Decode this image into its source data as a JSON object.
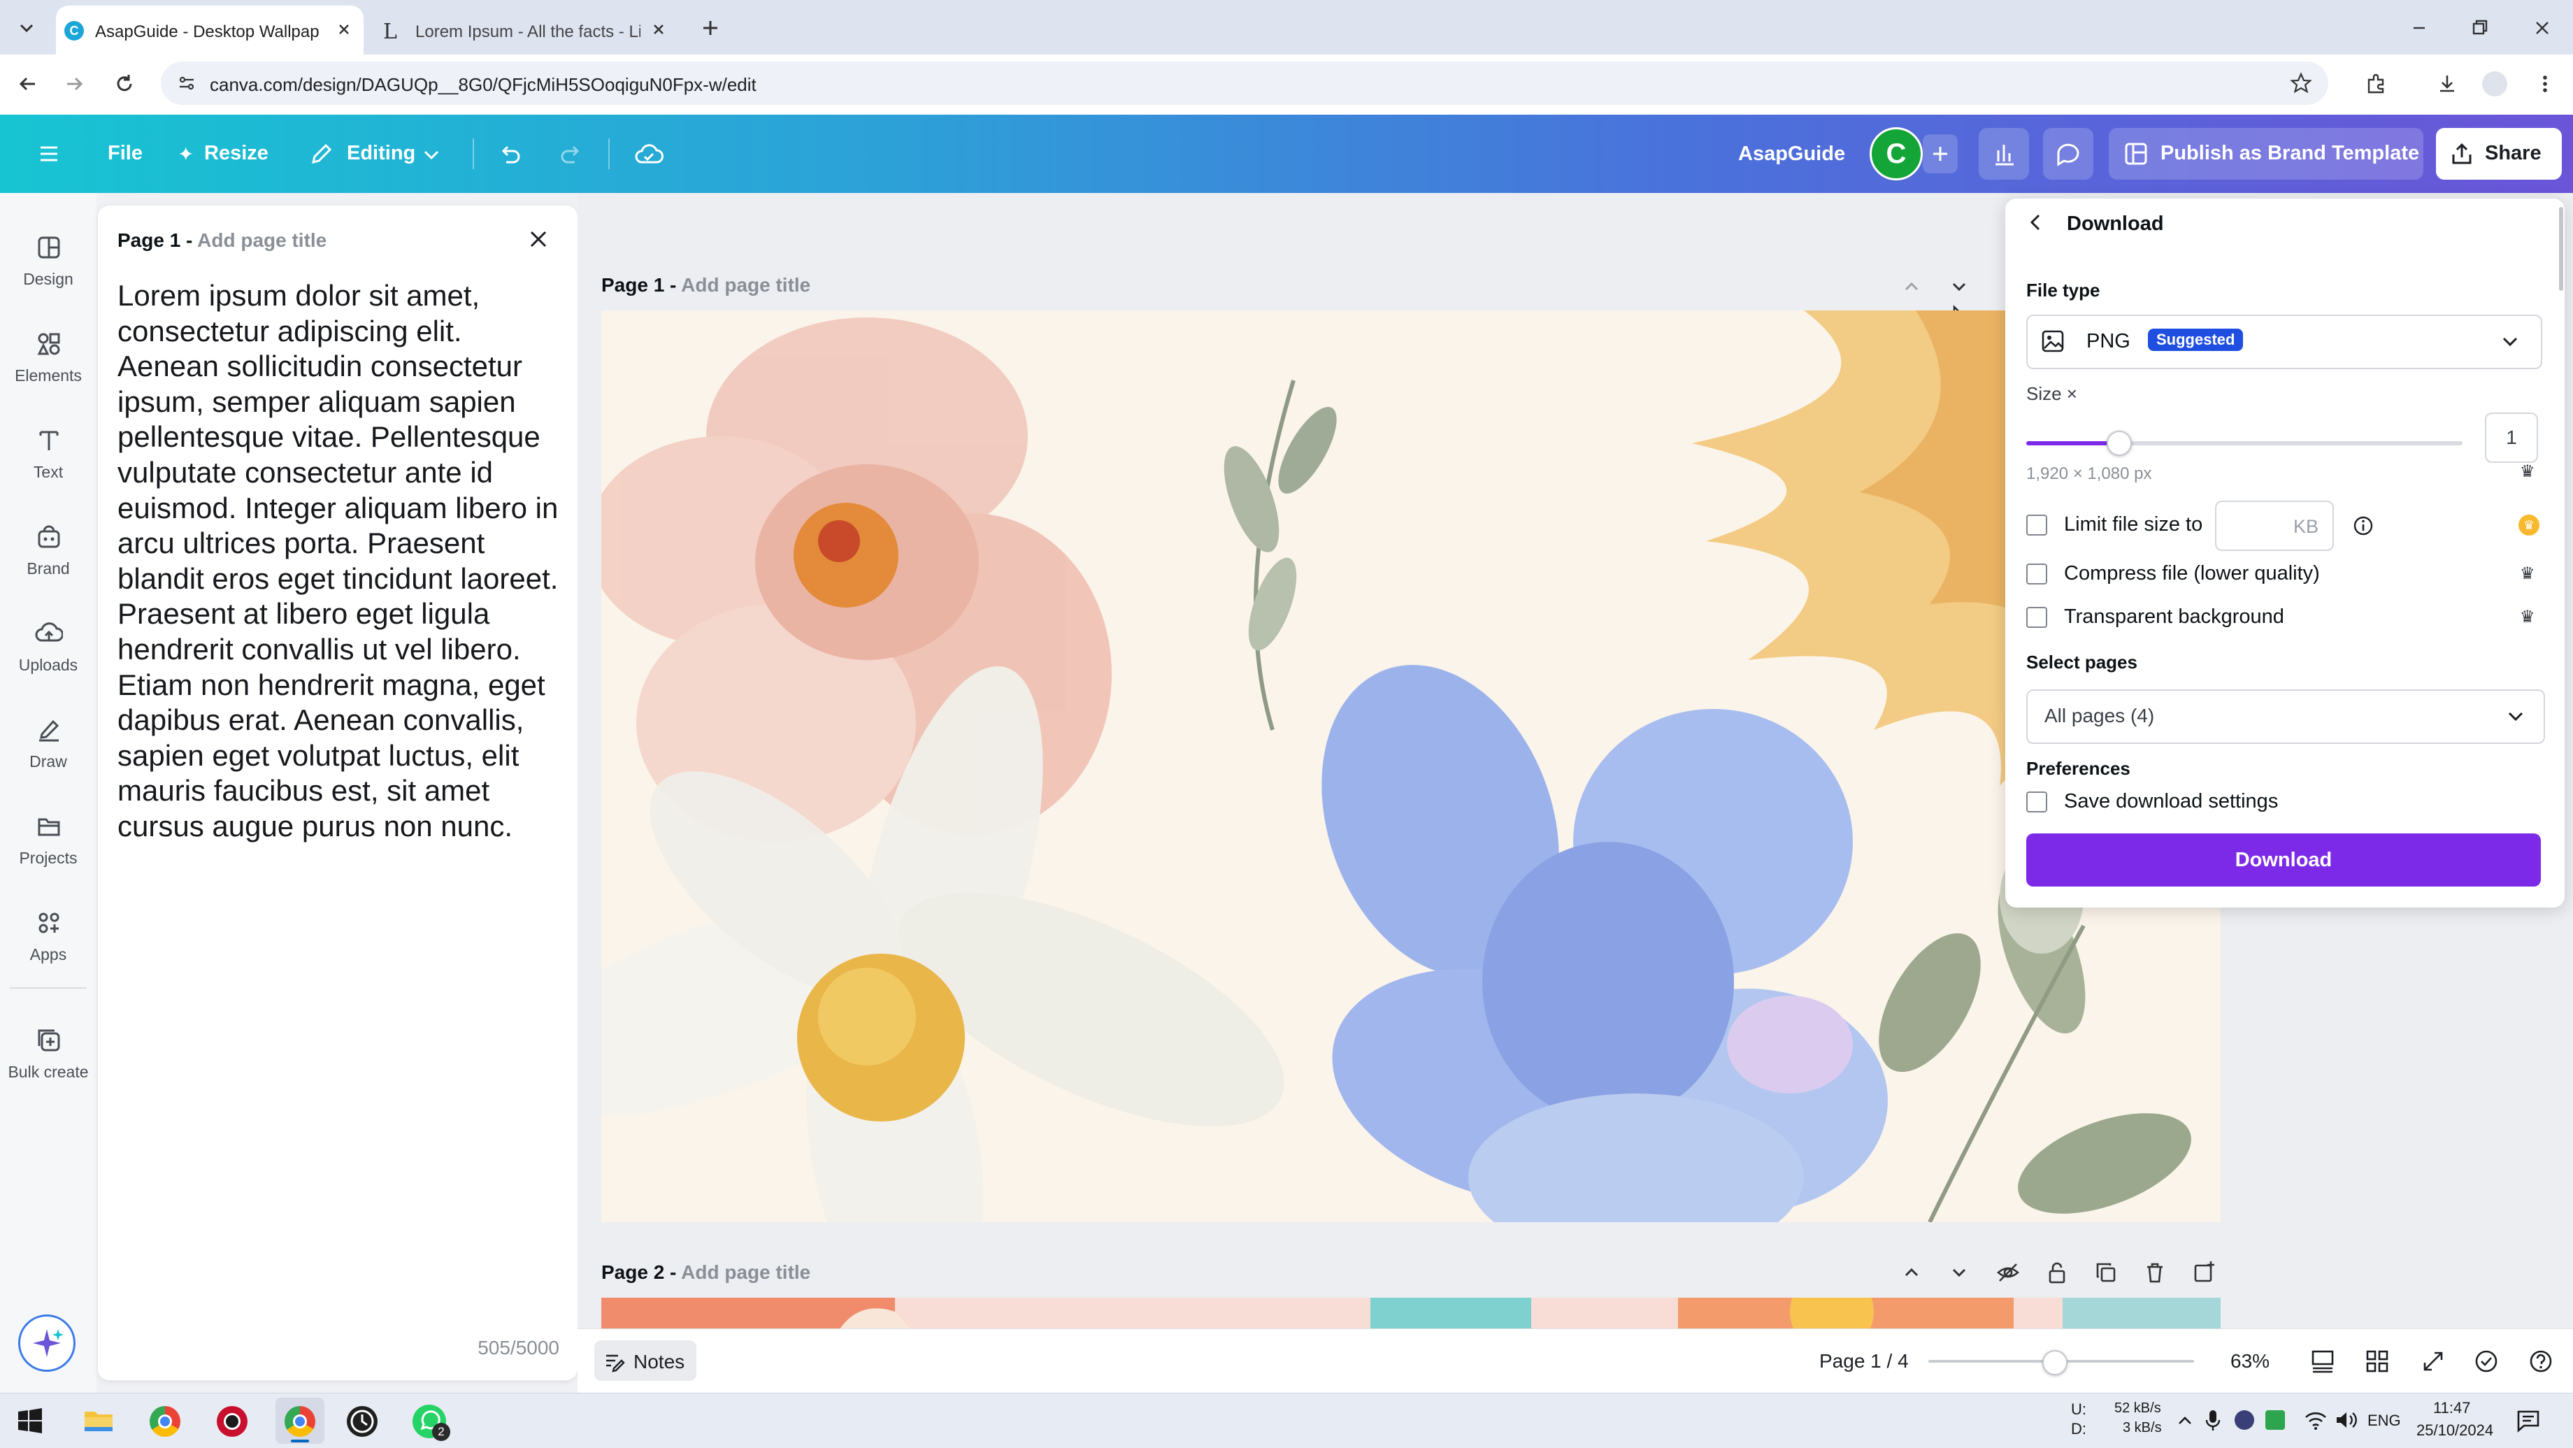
{
  "browser": {
    "tabs": [
      {
        "title": "AsapGuide - Desktop Wallpape",
        "active": true
      },
      {
        "title": "Lorem Ipsum - All the facts - Li",
        "active": false
      }
    ],
    "url": "canva.com/design/DAGUQp__8G0/QFjcMiH5SOoqiguN0Fpx-w/edit"
  },
  "header": {
    "file_label": "File",
    "resize_label": "Resize",
    "editing_label": "Editing",
    "brand_name": "AsapGuide",
    "avatar_initial": "C",
    "publish_label": "Publish as Brand Template",
    "share_label": "Share"
  },
  "left_rail": {
    "items": [
      {
        "label": "Design",
        "icon": "design-icon"
      },
      {
        "label": "Elements",
        "icon": "elements-icon"
      },
      {
        "label": "Text",
        "icon": "text-icon"
      },
      {
        "label": "Brand",
        "icon": "brand-icon"
      },
      {
        "label": "Uploads",
        "icon": "uploads-icon"
      },
      {
        "label": "Draw",
        "icon": "draw-icon"
      },
      {
        "label": "Projects",
        "icon": "projects-icon"
      },
      {
        "label": "Apps",
        "icon": "apps-icon"
      },
      {
        "label": "Bulk create",
        "icon": "bulk-create-icon"
      }
    ]
  },
  "notes": {
    "page_label": "Page 1 -",
    "page_title_placeholder": "Add page title",
    "body": "Lorem ipsum dolor sit amet, consectetur adipiscing elit. Aenean sollicitudin consectetur ipsum, semper aliquam sapien pellentesque vitae. Pellentesque vulputate consectetur ante id euismod. Integer aliquam libero in arcu ultrices porta. Praesent blandit eros eget tincidunt laoreet. Praesent at libero eget ligula hendrerit convallis ut vel libero. Etiam non hendrerit magna, eget dapibus erat. Aenean convallis, sapien eget volutpat luctus, elit mauris faucibus est, sit amet cursus augue purus non nunc.",
    "char_count": "505/5000"
  },
  "canvas": {
    "page1_label": "Page 1 -",
    "page2_label": "Page 2 -",
    "add_title": "Add page title"
  },
  "download": {
    "title": "Download",
    "file_type_label": "File type",
    "file_type_value": "PNG",
    "suggested_badge": "Suggested",
    "size_label": "Size ×",
    "size_value": "1",
    "size_fraction": 0.21,
    "dimensions": "1,920 × 1,080 px",
    "limit_label": "Limit file size to",
    "limit_unit": "KB",
    "compress_label": "Compress file (lower quality)",
    "transparent_label": "Transparent background",
    "select_pages_label": "Select pages",
    "pages_value": "All pages (4)",
    "preferences_label": "Preferences",
    "save_settings_label": "Save download settings",
    "download_button": "Download"
  },
  "bottom_bar": {
    "notes_label": "Notes",
    "page_indicator": "Page 1 / 4",
    "zoom": "63%",
    "zoom_fraction": 0.47
  },
  "taskbar": {
    "net_up_label": "U:",
    "net_down_label": "D:",
    "net_up": "52 kB/s",
    "net_down": "3 kB/s",
    "lang": "ENG",
    "time": "11:47",
    "date": "25/10/2024",
    "whatsapp_badge": "2"
  },
  "colors": {
    "accent_purple": "#7d2ae8",
    "suggested_blue": "#1f4fe0",
    "header_start": "#17c4d2",
    "header_end": "#6a55d8"
  }
}
